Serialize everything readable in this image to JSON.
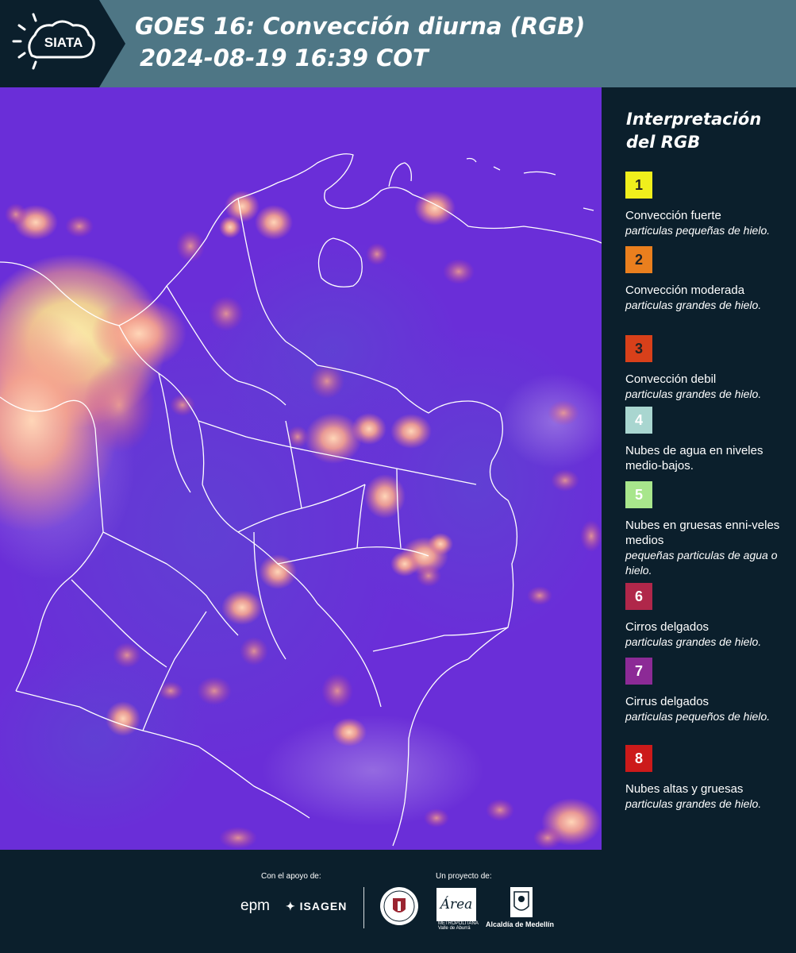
{
  "header": {
    "logo_text": "SIATA",
    "title_line1": "GOES 16: Convección diurna (RGB)",
    "title_line2": "2024-08-19 16:39 COT",
    "background_color": "#4e7685"
  },
  "map": {
    "description_icon": "satellite-rgb-map",
    "base_color": "#6b2fd6",
    "boundary_color": "#ffffff"
  },
  "legend": {
    "title_line1": "Interpretación",
    "title_line2": "del RGB",
    "items": [
      {
        "number": "1",
        "color": "#f0ef1c",
        "text_color": "#222222",
        "name": "Convección fuerte",
        "desc": "particulas pequeñas de hielo."
      },
      {
        "number": "2",
        "color": "#ea7f1e",
        "text_color": "#222222",
        "name": "Convección moderada",
        "desc": "particulas grandes de hielo."
      },
      {
        "number": "3",
        "color": "#d8401a",
        "text_color": "#222222",
        "name": "Convección debil",
        "desc": "particulas grandes de hielo."
      },
      {
        "number": "4",
        "color": "#a9d6d0",
        "text_color": "#ffffff",
        "name": "Nubes de agua en niveles medio-bajos.",
        "desc": ""
      },
      {
        "number": "5",
        "color": "#a8e68c",
        "text_color": "#ffffff",
        "name": "Nubes en gruesas enni-veles medios",
        "desc": "pequeñas particulas de agua o hielo."
      },
      {
        "number": "6",
        "color": "#b0274a",
        "text_color": "#ffffff",
        "name": "Cirros delgados",
        "desc": "particulas grandes de hielo."
      },
      {
        "number": "7",
        "color": "#8c2a96",
        "text_color": "#ffffff",
        "name": "Cirrus delgados",
        "desc": "particulas pequeños de hielo."
      },
      {
        "number": "8",
        "color": "#cc1a1a",
        "text_color": "#ffffff",
        "name": "Nubes altas y gruesas",
        "desc": "particulas grandes de hielo."
      }
    ]
  },
  "footer": {
    "support_label": "Con el apoyo de:",
    "project_label": "Un proyecto de:",
    "epm": "epm",
    "isagen": "ISAGEN",
    "area_name": "Área",
    "area_sub": "METROPOLITANA Valle de Aburrá",
    "medellin": "Alcaldía de Medellín"
  }
}
